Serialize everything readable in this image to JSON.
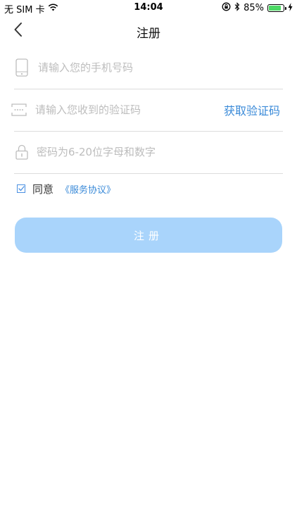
{
  "status_bar": {
    "carrier": "无 SIM 卡",
    "time": "14:04",
    "battery_percent": "85%",
    "battery_level": 0.85,
    "icons": [
      "wifi-icon",
      "orientation-lock-icon",
      "bluetooth-icon",
      "battery-icon",
      "charging-icon"
    ]
  },
  "nav": {
    "title": "注册",
    "back_icon": "chevron-left-icon"
  },
  "form": {
    "phone": {
      "placeholder": "请输入您的手机号码",
      "value": "",
      "icon": "phone-icon"
    },
    "code": {
      "placeholder": "请输入您收到的验证码",
      "value": "",
      "icon": "sms-code-icon",
      "action_label": "获取验证码"
    },
    "password": {
      "placeholder": "密码为6-20位字母和数字",
      "value": "",
      "icon": "lock-icon"
    }
  },
  "agreement": {
    "checked": true,
    "label": "同意",
    "link_label": "《服务协议》"
  },
  "submit": {
    "label": "注册"
  },
  "colors": {
    "accent": "#3a8ad8",
    "button_bg": "#a9d4fb",
    "divider": "#dcdcdc",
    "placeholder": "#bdbdbd"
  }
}
